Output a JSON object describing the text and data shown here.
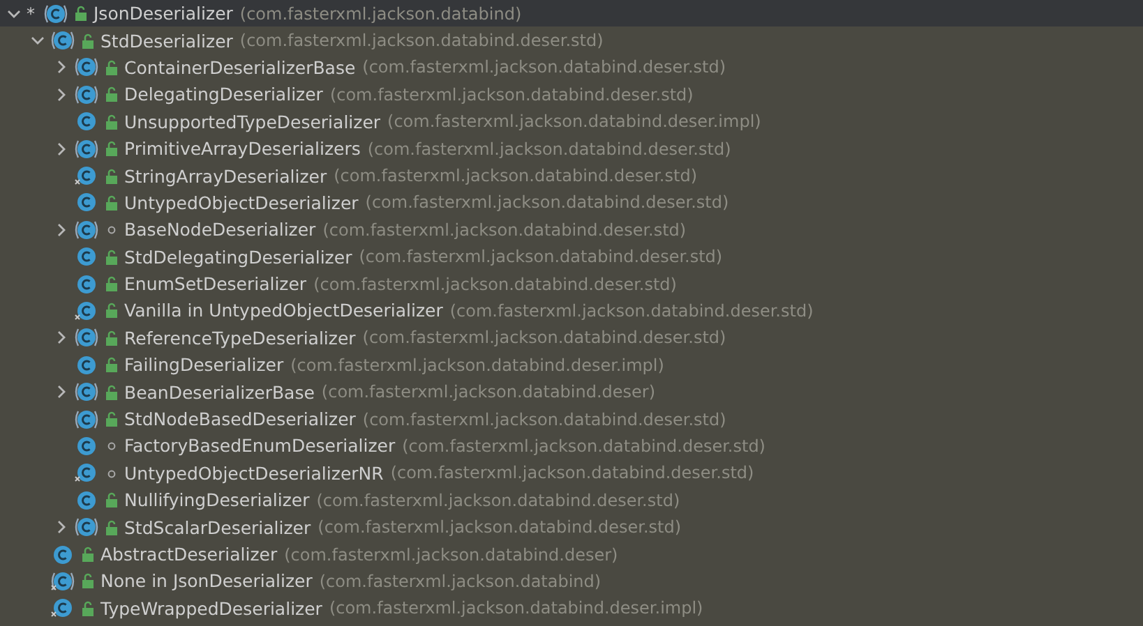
{
  "tree": [
    {
      "name": "JsonDeserializer",
      "package": "(com.fasterxml.jackson.databind)",
      "marker": "*",
      "kind": "abstract",
      "public": true,
      "selected": true,
      "expanded": true,
      "children": [
        {
          "name": "StdDeserializer",
          "package": "(com.fasterxml.jackson.databind.deser.std)",
          "kind": "abstract",
          "public": true,
          "selected": false,
          "expanded": true,
          "children": [
            {
              "name": "ContainerDeserializerBase",
              "package": "(com.fasterxml.jackson.databind.deser.std)",
              "kind": "abstract",
              "public": true,
              "selected": false,
              "expanded": false
            },
            {
              "name": "DelegatingDeserializer",
              "package": "(com.fasterxml.jackson.databind.deser.std)",
              "kind": "abstract",
              "public": true,
              "selected": false,
              "expanded": false
            },
            {
              "name": "UnsupportedTypeDeserializer",
              "package": "(com.fasterxml.jackson.databind.deser.impl)",
              "kind": "class",
              "public": true,
              "selected": false
            },
            {
              "name": "PrimitiveArrayDeserializers",
              "package": "(com.fasterxml.jackson.databind.deser.std)",
              "kind": "abstract",
              "public": true,
              "selected": false,
              "expanded": false
            },
            {
              "name": "StringArrayDeserializer",
              "package": "(com.fasterxml.jackson.databind.deser.std)",
              "kind": "final",
              "public": true,
              "selected": false
            },
            {
              "name": "UntypedObjectDeserializer",
              "package": "(com.fasterxml.jackson.databind.deser.std)",
              "kind": "class",
              "public": true,
              "selected": false
            },
            {
              "name": "BaseNodeDeserializer",
              "package": "(com.fasterxml.jackson.databind.deser.std)",
              "kind": "abstract",
              "public": false,
              "selected": false,
              "expanded": false
            },
            {
              "name": "StdDelegatingDeserializer",
              "package": "(com.fasterxml.jackson.databind.deser.std)",
              "kind": "class",
              "public": true,
              "selected": false
            },
            {
              "name": "EnumSetDeserializer",
              "package": "(com.fasterxml.jackson.databind.deser.std)",
              "kind": "class",
              "public": true,
              "selected": false
            },
            {
              "name": "Vanilla in UntypedObjectDeserializer",
              "package": "(com.fasterxml.jackson.databind.deser.std)",
              "kind": "final",
              "public": true,
              "selected": false
            },
            {
              "name": "ReferenceTypeDeserializer",
              "package": "(com.fasterxml.jackson.databind.deser.std)",
              "kind": "abstract",
              "public": true,
              "selected": false,
              "expanded": false
            },
            {
              "name": "FailingDeserializer",
              "package": "(com.fasterxml.jackson.databind.deser.impl)",
              "kind": "class",
              "public": true,
              "selected": false
            },
            {
              "name": "BeanDeserializerBase",
              "package": "(com.fasterxml.jackson.databind.deser)",
              "kind": "abstract",
              "public": true,
              "selected": false,
              "expanded": false
            },
            {
              "name": "StdNodeBasedDeserializer",
              "package": "(com.fasterxml.jackson.databind.deser.std)",
              "kind": "abstract",
              "public": true,
              "selected": false
            },
            {
              "name": "FactoryBasedEnumDeserializer",
              "package": "(com.fasterxml.jackson.databind.deser.std)",
              "kind": "class",
              "public": false,
              "selected": false
            },
            {
              "name": "UntypedObjectDeserializerNR",
              "package": "(com.fasterxml.jackson.databind.deser.std)",
              "kind": "final",
              "public": false,
              "selected": false
            },
            {
              "name": "NullifyingDeserializer",
              "package": "(com.fasterxml.jackson.databind.deser.std)",
              "kind": "class",
              "public": true,
              "selected": false
            },
            {
              "name": "StdScalarDeserializer",
              "package": "(com.fasterxml.jackson.databind.deser.std)",
              "kind": "abstract",
              "public": true,
              "selected": false,
              "expanded": false
            }
          ]
        },
        {
          "name": "AbstractDeserializer",
          "package": "(com.fasterxml.jackson.databind.deser)",
          "kind": "class",
          "public": true,
          "selected": false
        },
        {
          "name": "None in JsonDeserializer",
          "package": "(com.fasterxml.jackson.databind)",
          "kind": "abstract_final",
          "public": true,
          "selected": false
        },
        {
          "name": "TypeWrappedDeserializer",
          "package": "(com.fasterxml.jackson.databind.deser.impl)",
          "kind": "final",
          "public": true,
          "selected": false
        }
      ]
    }
  ]
}
